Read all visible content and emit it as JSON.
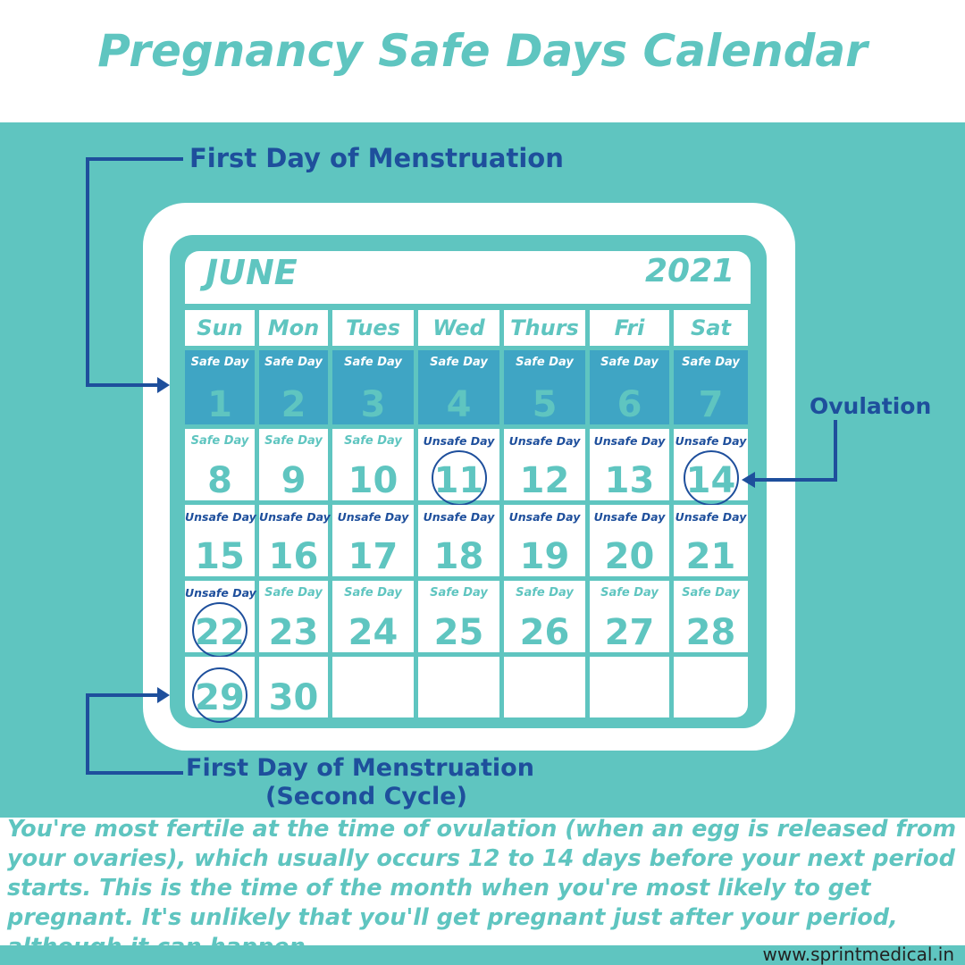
{
  "title": "Pregnancy Safe Days Calendar",
  "calendar": {
    "month": "JUNE",
    "year": "2021",
    "weekdays": [
      "Sun",
      "Mon",
      "Tues",
      "Wed",
      "Thurs",
      "Fri",
      "Sat"
    ],
    "days": [
      {
        "day": "1",
        "label": "Safe Day",
        "status": "safe",
        "highlight": true
      },
      {
        "day": "2",
        "label": "Safe Day",
        "status": "safe",
        "highlight": true
      },
      {
        "day": "3",
        "label": "Safe Day",
        "status": "safe",
        "highlight": true
      },
      {
        "day": "4",
        "label": "Safe Day",
        "status": "safe",
        "highlight": true
      },
      {
        "day": "5",
        "label": "Safe Day",
        "status": "safe",
        "highlight": true
      },
      {
        "day": "6",
        "label": "Safe Day",
        "status": "safe",
        "highlight": true
      },
      {
        "day": "7",
        "label": "Safe Day",
        "status": "safe",
        "highlight": true
      },
      {
        "day": "8",
        "label": "Safe Day",
        "status": "safe"
      },
      {
        "day": "9",
        "label": "Safe Day",
        "status": "safe"
      },
      {
        "day": "10",
        "label": "Safe Day",
        "status": "safe"
      },
      {
        "day": "11",
        "label": "Unsafe Day",
        "status": "unsafe",
        "circled": true
      },
      {
        "day": "12",
        "label": "Unsafe Day",
        "status": "unsafe"
      },
      {
        "day": "13",
        "label": "Unsafe Day",
        "status": "unsafe"
      },
      {
        "day": "14",
        "label": "Unsafe Day",
        "status": "unsafe",
        "circled": true
      },
      {
        "day": "15",
        "label": "Unsafe Day",
        "status": "unsafe"
      },
      {
        "day": "16",
        "label": "Unsafe Day",
        "status": "unsafe"
      },
      {
        "day": "17",
        "label": "Unsafe Day",
        "status": "unsafe"
      },
      {
        "day": "18",
        "label": "Unsafe Day",
        "status": "unsafe"
      },
      {
        "day": "19",
        "label": "Unsafe Day",
        "status": "unsafe"
      },
      {
        "day": "20",
        "label": "Unsafe Day",
        "status": "unsafe"
      },
      {
        "day": "21",
        "label": "Unsafe Day",
        "status": "unsafe"
      },
      {
        "day": "22",
        "label": "Unsafe Day",
        "status": "unsafe",
        "circled": true
      },
      {
        "day": "23",
        "label": "Safe Day",
        "status": "safe"
      },
      {
        "day": "24",
        "label": "Safe Day",
        "status": "safe"
      },
      {
        "day": "25",
        "label": "Safe Day",
        "status": "safe"
      },
      {
        "day": "26",
        "label": "Safe Day",
        "status": "safe"
      },
      {
        "day": "27",
        "label": "Safe Day",
        "status": "safe"
      },
      {
        "day": "28",
        "label": "Safe Day",
        "status": "safe"
      },
      {
        "day": "29",
        "label": "",
        "status": "none",
        "circled": true
      },
      {
        "day": "30",
        "label": "",
        "status": "none"
      },
      {
        "day": "",
        "label": "",
        "status": "none"
      },
      {
        "day": "",
        "label": "",
        "status": "none"
      },
      {
        "day": "",
        "label": "",
        "status": "none"
      },
      {
        "day": "",
        "label": "",
        "status": "none"
      },
      {
        "day": "",
        "label": "",
        "status": "none"
      }
    ]
  },
  "callouts": {
    "first_day": "First Day of Menstruation",
    "ovulation": "Ovulation",
    "second_cycle_line1": "First Day of Menstruation",
    "second_cycle_line2": "(Second Cycle)"
  },
  "description": "You're most fertile at the time of ovulation (when an egg is released from your ovaries), which usually occurs 12 to 14 days before your next period starts. This is the time of the month when you're most likely to get pregnant. It's unlikely that you'll get pregnant just after your period, although it can happen.",
  "website": "www.sprintmedical.in",
  "colors": {
    "teal": "#5fc5c0",
    "blue_row": "#3fa5c4",
    "navy": "#1e4f9c"
  }
}
